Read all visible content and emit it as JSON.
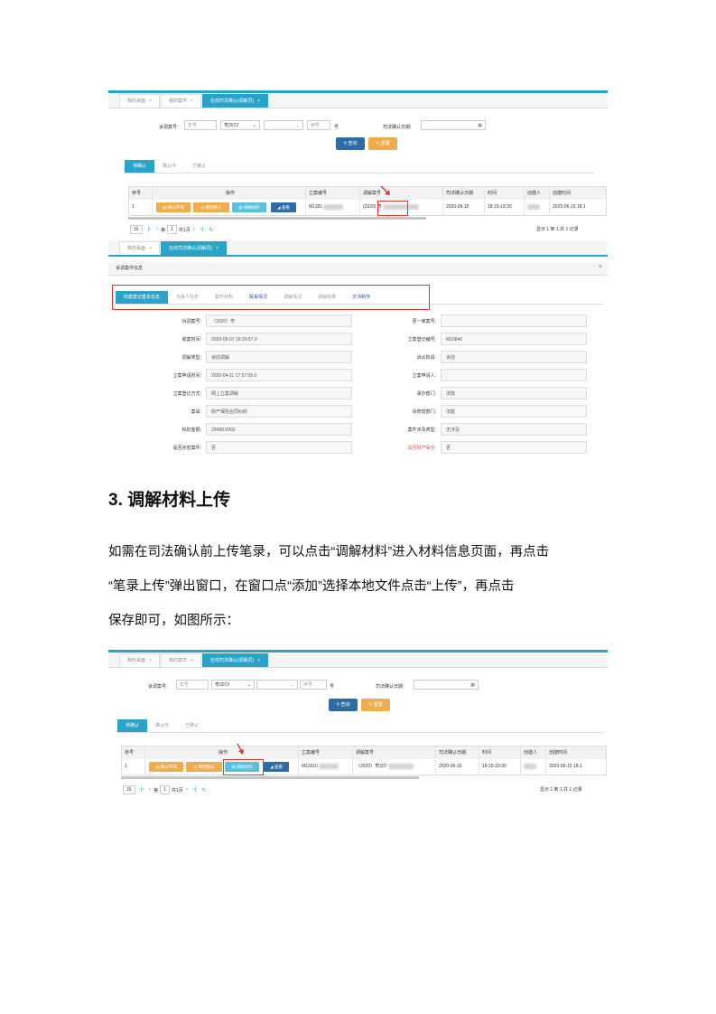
{
  "shot1": {
    "tabs": [
      {
        "label": "我的桌面",
        "close": "×"
      },
      {
        "label": "我的案件",
        "close": "×"
      },
      {
        "label": "在线司法确认(调解员)",
        "close": "×"
      }
    ],
    "search": {
      "case_no_label": "诉调案号:",
      "year_placeholder": "年号",
      "court_value": "粤2072",
      "seq_placeholder": "序号",
      "hao": "号",
      "date_label": "司法确认日期:",
      "query_label": "查询",
      "reset_label": "重置"
    },
    "subtabs": [
      "待确认",
      "确认中",
      "已确认"
    ],
    "columns": [
      "序号",
      "操作",
      "立案编号",
      "调解案号",
      "司法确认日期",
      "时间",
      "创建人",
      "创建时间"
    ],
    "row": {
      "index": "1",
      "btn_apply": "▤ 确认申请",
      "btn_withdraw": "⊖ 撤回确认",
      "btn_material": "▤ 调解材料",
      "btn_view": "◢ 查看",
      "case_id": "M1181",
      "mediation_no": "(2020) 粤",
      "confirm_date": "2020-06-15",
      "time": "18:15-18:30",
      "created": "2020-06-15 18:1"
    },
    "pager": {
      "size": "15",
      "page_prefix": "第",
      "page": "1",
      "page_suffix": "共1页",
      "info": "显示 1 到 1,共 1 记录"
    }
  },
  "shot2": {
    "tabs": [
      {
        "label": "我的桌面",
        "close": "×"
      },
      {
        "label": "在线司法确认(调解员)",
        "close": "×"
      }
    ],
    "panel_title": "诉调案件信息",
    "close": "×",
    "subtabs": [
      "收案登记基本信息",
      "当事人信息",
      "案件材料",
      "联系情况",
      "调解情况",
      "调解结果",
      "文书制作"
    ],
    "fields_left": [
      {
        "label": "诉调案号:",
        "value": "（2020）粤"
      },
      {
        "label": "收案时间:",
        "value": "2020-05-07 16:29:57.0"
      },
      {
        "label": "调解类型:",
        "value": "诉前调解"
      },
      {
        "label": "立案申请时间:",
        "value": "2020-04-11 17:57:09.0"
      },
      {
        "label": "立案登记方式:",
        "value": "网上立案调解"
      },
      {
        "label": "案由:",
        "value": "财产保险合同纠纷"
      },
      {
        "label": "标的金额:",
        "value": "29499.0000"
      },
      {
        "label": "是否涉密案件:",
        "value": "否"
      }
    ],
    "fields_right": [
      {
        "label": "原一审案号:",
        "value": ""
      },
      {
        "label": "立案登记编号:",
        "value": "M10840"
      },
      {
        "label": "诉讼阶段:",
        "value": "诉前"
      },
      {
        "label": "立案申请人:",
        "value": ""
      },
      {
        "label": "承办部门:",
        "value": "法院"
      },
      {
        "label": "诉管辖部门:",
        "value": "法庭"
      },
      {
        "label": "案件涉及类型:",
        "value": "无涉及"
      },
      {
        "label": "是否财产保全:",
        "value": "否"
      }
    ]
  },
  "heading": "3. 调解材料上传",
  "paragraph": [
    "如需在司法确认前上传笔录，可以点击“调解材料”进入材料信息页面，再点击",
    "“笔录上传”弹出窗口，在窗口点“添加”选择本地文件点击“上传”，再点击",
    "保存即可，如图所示："
  ],
  "shot3": {
    "tabs": [
      {
        "label": "我的桌面",
        "close": "×"
      },
      {
        "label": "我的案件",
        "close": "×"
      },
      {
        "label": "在线司法确认(调解员)",
        "close": "×"
      }
    ],
    "search": {
      "case_no_label": "诉调案号:",
      "year_placeholder": "年号",
      "court_value": "粤2072",
      "seq_placeholder": "序号",
      "hao": "号",
      "date_label": "司法确认日期:",
      "query_label": "查询",
      "reset_label": "重置"
    },
    "subtabs": [
      "待确认",
      "确认中",
      "已确认"
    ],
    "columns": [
      "序号",
      "操作",
      "立案编号",
      "调解案号",
      "司法确认日期",
      "时间",
      "创建人",
      "创建时间"
    ],
    "row": {
      "index": "1",
      "btn_apply": "▤ 确认申请",
      "btn_withdraw": "⊖ 撤回确认",
      "btn_material": "▤ 调解材料",
      "btn_view": "◢ 查看",
      "case_id": "M11610",
      "mediation_no": "（2020）粤207",
      "confirm_date": "2020-06-15",
      "time": "18:15-18:30",
      "created": "2020-06-15 18:1"
    },
    "pager": {
      "size": "15",
      "page_prefix": "第",
      "page": "1",
      "page_suffix": "共1页",
      "info": "显示 1 到 1,共 1 记录"
    }
  },
  "colors": {
    "accent": "#2aa3c9",
    "query": "#2e6da4",
    "reset": "#f0ad4e",
    "view": "#5bc0de",
    "highlight": "#e3342f"
  }
}
